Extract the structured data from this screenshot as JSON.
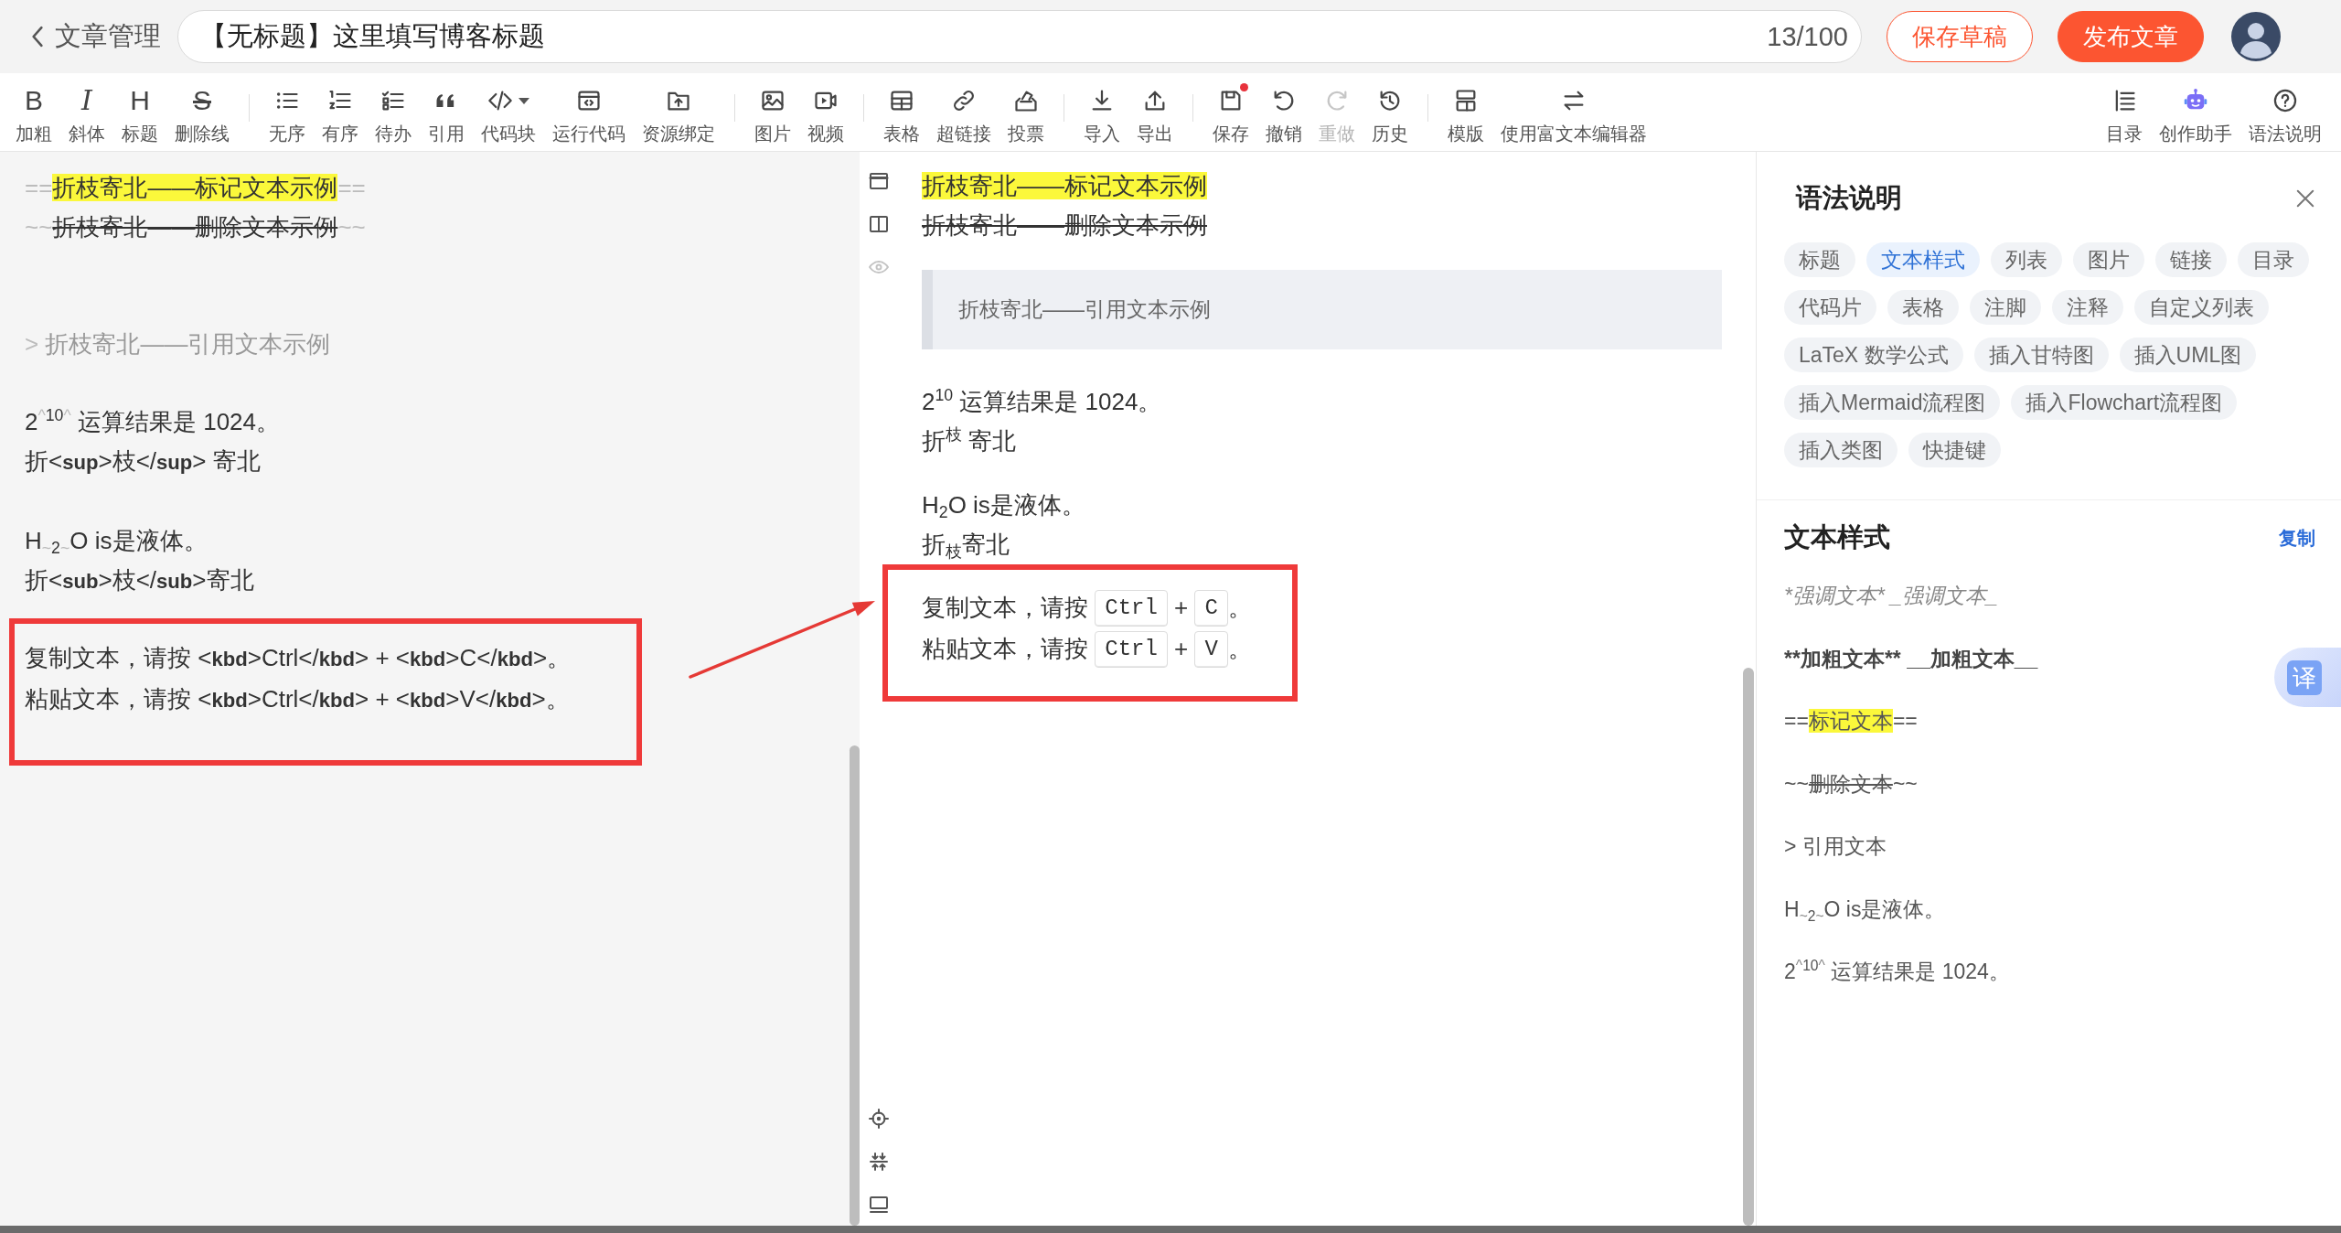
{
  "header": {
    "back": {
      "label": "文章管理"
    },
    "title_field": {
      "value": "【无标题】这里填写博客标题",
      "counter": "13/100"
    },
    "buttons": [
      {
        "label": "保存草稿",
        "kind": "outline"
      },
      {
        "label": "发布文章",
        "kind": "primary"
      }
    ]
  },
  "toolbar": {
    "groups": [
      [
        {
          "label": "加粗",
          "glyph": "B",
          "disabled": false,
          "dropdown": false,
          "dot": false
        },
        {
          "label": "斜体",
          "glyph": "I",
          "disabled": false,
          "dropdown": false,
          "dot": false
        },
        {
          "label": "标题",
          "glyph": "H",
          "disabled": false,
          "dropdown": false,
          "dot": false
        },
        {
          "label": "删除线",
          "glyph": "S",
          "disabled": false,
          "dropdown": false,
          "dot": false
        }
      ],
      [
        {
          "label": "无序",
          "disabled": false,
          "dropdown": false,
          "dot": false
        },
        {
          "label": "有序",
          "disabled": false,
          "dropdown": false,
          "dot": false
        },
        {
          "label": "待办",
          "disabled": false,
          "dropdown": false,
          "dot": false
        },
        {
          "label": "引用",
          "disabled": false,
          "dropdown": false,
          "dot": false
        },
        {
          "label": "代码块",
          "disabled": false,
          "dropdown": true,
          "dot": false
        },
        {
          "label": "运行代码",
          "disabled": false,
          "dropdown": false,
          "dot": false
        },
        {
          "label": "资源绑定",
          "disabled": false,
          "dropdown": false,
          "dot": false
        }
      ],
      [
        {
          "label": "图片",
          "disabled": false,
          "dropdown": false,
          "dot": false
        },
        {
          "label": "视频",
          "disabled": false,
          "dropdown": false,
          "dot": false
        }
      ],
      [
        {
          "label": "表格",
          "disabled": false,
          "dropdown": false,
          "dot": false
        },
        {
          "label": "超链接",
          "disabled": false,
          "dropdown": false,
          "dot": false
        },
        {
          "label": "投票",
          "disabled": false,
          "dropdown": false,
          "dot": false
        }
      ],
      [
        {
          "label": "导入",
          "disabled": false,
          "dropdown": false,
          "dot": false
        },
        {
          "label": "导出",
          "disabled": false,
          "dropdown": false,
          "dot": false
        }
      ],
      [
        {
          "label": "保存",
          "disabled": false,
          "dropdown": false,
          "dot": true
        },
        {
          "label": "撤销",
          "disabled": false,
          "dropdown": false,
          "dot": false
        },
        {
          "label": "重做",
          "disabled": true,
          "dropdown": false,
          "dot": false
        },
        {
          "label": "历史",
          "disabled": false,
          "dropdown": false,
          "dot": false
        }
      ],
      [
        {
          "label": "模版",
          "disabled": false,
          "dropdown": false,
          "dot": false
        },
        {
          "label": "使用富文本编辑器",
          "disabled": false,
          "dropdown": false,
          "dot": false
        }
      ]
    ],
    "right": [
      {
        "label": "目录"
      },
      {
        "label": "创作助手"
      },
      {
        "label": "语法说明"
      }
    ]
  },
  "editor": {
    "blocks": [
      {
        "annotated": false,
        "lines": [
          {
            "kind": "text",
            "segments": [
              {
                "kind": "marker",
                "text": "=="
              },
              {
                "kind": "mark",
                "text": "折枝寄北——标记文本示例"
              },
              {
                "kind": "marker",
                "text": "=="
              }
            ]
          },
          {
            "kind": "text",
            "segments": [
              {
                "kind": "marker",
                "text": "~~"
              },
              {
                "kind": "strike",
                "text": "折枝寄北——删除文本示例"
              },
              {
                "kind": "marker",
                "text": "~~"
              }
            ]
          },
          {
            "kind": "blank"
          },
          {
            "kind": "blank"
          },
          {
            "kind": "text",
            "segments": [
              {
                "kind": "marker",
                "text": ">"
              },
              {
                "kind": "quote",
                "text": " 折枝寄北——引用文本示例"
              }
            ]
          },
          {
            "kind": "blank"
          },
          {
            "kind": "text",
            "segments": [
              {
                "kind": "text",
                "text": "2"
              },
              {
                "kind": "sup_marker",
                "text": "^"
              },
              {
                "kind": "sup",
                "text": "10"
              },
              {
                "kind": "sup_marker",
                "text": "^"
              },
              {
                "kind": "text",
                "text": " 运算结果是 1024。"
              }
            ]
          },
          {
            "kind": "text",
            "segments": [
              {
                "kind": "text",
                "text": "折<"
              },
              {
                "kind": "tag",
                "text": "sup"
              },
              {
                "kind": "text",
                "text": ">枝</"
              },
              {
                "kind": "tag",
                "text": "sup"
              },
              {
                "kind": "text",
                "text": "> 寄北"
              }
            ]
          },
          {
            "kind": "blank"
          },
          {
            "kind": "text",
            "segments": [
              {
                "kind": "text",
                "text": "H"
              },
              {
                "kind": "sub_marker",
                "text": "~"
              },
              {
                "kind": "sub",
                "text": "2"
              },
              {
                "kind": "sub_marker",
                "text": "~"
              },
              {
                "kind": "text",
                "text": "O is是液体。"
              }
            ]
          },
          {
            "kind": "text",
            "segments": [
              {
                "kind": "text",
                "text": "折<"
              },
              {
                "kind": "tag",
                "text": "sub"
              },
              {
                "kind": "text",
                "text": ">枝</"
              },
              {
                "kind": "tag",
                "text": "sub"
              },
              {
                "kind": "text",
                "text": ">寄北"
              }
            ]
          }
        ]
      },
      {
        "annotated": true,
        "lines": [
          {
            "kind": "text",
            "segments": [
              {
                "kind": "text",
                "text": "复制文本，请按 <"
              },
              {
                "kind": "tag",
                "text": "kbd"
              },
              {
                "kind": "text",
                "text": ">Ctrl</"
              },
              {
                "kind": "tag",
                "text": "kbd"
              },
              {
                "kind": "text",
                "text": "> + <"
              },
              {
                "kind": "tag",
                "text": "kbd"
              },
              {
                "kind": "text",
                "text": ">C</"
              },
              {
                "kind": "tag",
                "text": "kbd"
              },
              {
                "kind": "text",
                "text": ">。"
              }
            ]
          },
          {
            "kind": "text",
            "segments": [
              {
                "kind": "text",
                "text": "粘贴文本，请按 <"
              },
              {
                "kind": "tag",
                "text": "kbd"
              },
              {
                "kind": "text",
                "text": ">Ctrl</"
              },
              {
                "kind": "tag",
                "text": "kbd"
              },
              {
                "kind": "text",
                "text": "> + <"
              },
              {
                "kind": "tag",
                "text": "kbd"
              },
              {
                "kind": "text",
                "text": ">V</"
              },
              {
                "kind": "tag",
                "text": "kbd"
              },
              {
                "kind": "text",
                "text": ">。"
              }
            ]
          }
        ]
      }
    ]
  },
  "annotation_arrow": true,
  "preview": {
    "blocks": [
      {
        "kind": "paragraph",
        "annotated": false,
        "lines": [
          {
            "kind": "text",
            "segments": [
              {
                "kind": "mark",
                "text": "折枝寄北——标记文本示例"
              }
            ]
          },
          {
            "kind": "text",
            "segments": [
              {
                "kind": "strike",
                "text": "折枝寄北——删除文本示例"
              }
            ]
          }
        ]
      },
      {
        "kind": "quote",
        "text": "折枝寄北——引用文本示例"
      },
      {
        "kind": "paragraph",
        "annotated": false,
        "lines": [
          {
            "kind": "text",
            "segments": [
              {
                "kind": "text",
                "text": "2"
              },
              {
                "kind": "sup",
                "text": "10"
              },
              {
                "kind": "text",
                "text": " 运算结果是 1024。"
              }
            ]
          },
          {
            "kind": "text",
            "segments": [
              {
                "kind": "text",
                "text": "折"
              },
              {
                "kind": "sup",
                "text": "枝"
              },
              {
                "kind": "text",
                "text": " 寄北"
              }
            ]
          }
        ]
      },
      {
        "kind": "paragraph",
        "annotated": false,
        "lines": [
          {
            "kind": "text",
            "segments": [
              {
                "kind": "text",
                "text": "H"
              },
              {
                "kind": "sub",
                "text": "2"
              },
              {
                "kind": "text",
                "text": "O is是液体。"
              }
            ]
          },
          {
            "kind": "text",
            "segments": [
              {
                "kind": "text",
                "text": "折"
              },
              {
                "kind": "sub",
                "text": "枝"
              },
              {
                "kind": "text",
                "text": "寄北"
              }
            ]
          }
        ]
      },
      {
        "kind": "paragraph",
        "annotated": true,
        "lines": [
          {
            "kind": "keys",
            "segments": [
              {
                "kind": "text",
                "text": "复制文本，请按 "
              },
              {
                "kind": "kbd",
                "text": "Ctrl"
              },
              {
                "kind": "text",
                "text": " + "
              },
              {
                "kind": "kbd",
                "text": "C"
              },
              {
                "kind": "text",
                "text": "。"
              }
            ]
          },
          {
            "kind": "keys",
            "segments": [
              {
                "kind": "text",
                "text": "粘贴文本，请按 "
              },
              {
                "kind": "kbd",
                "text": "Ctrl"
              },
              {
                "kind": "text",
                "text": " + "
              },
              {
                "kind": "kbd",
                "text": "V"
              },
              {
                "kind": "text",
                "text": "。"
              }
            ]
          }
        ]
      }
    ]
  },
  "syntax_panel": {
    "title": "语法说明",
    "tags": [
      {
        "label": "标题",
        "selected": false
      },
      {
        "label": "文本样式",
        "selected": true
      },
      {
        "label": "列表",
        "selected": false
      },
      {
        "label": "图片",
        "selected": false
      },
      {
        "label": "链接",
        "selected": false
      },
      {
        "label": "目录",
        "selected": false
      },
      {
        "label": "代码片",
        "selected": false
      },
      {
        "label": "表格",
        "selected": false
      },
      {
        "label": "注脚",
        "selected": false
      },
      {
        "label": "注释",
        "selected": false
      },
      {
        "label": "自定义列表",
        "selected": false
      },
      {
        "label": "LaTeX 数学公式",
        "selected": false
      },
      {
        "label": "插入甘特图",
        "selected": false
      },
      {
        "label": "插入UML图",
        "selected": false
      },
      {
        "label": "插入Mermaid流程图",
        "selected": false
      },
      {
        "label": "插入Flowchart流程图",
        "selected": false
      },
      {
        "label": "插入类图",
        "selected": false
      },
      {
        "label": "快捷键",
        "selected": false
      }
    ],
    "section": {
      "title": "文本样式",
      "copy": "复制",
      "lines": [
        {
          "segments": [
            {
              "kind": "italic",
              "text": "*强调文本* _强调文本_"
            }
          ]
        },
        {
          "segments": [
            {
              "kind": "bold",
              "text": "**加粗文本** __加粗文本__"
            }
          ]
        },
        {
          "segments": [
            {
              "kind": "text",
              "text": "=="
            },
            {
              "kind": "mark",
              "text": "标记文本"
            },
            {
              "kind": "text",
              "text": "=="
            }
          ]
        },
        {
          "segments": [
            {
              "kind": "text",
              "text": "~~"
            },
            {
              "kind": "strike",
              "text": "删除文本"
            },
            {
              "kind": "text",
              "text": "~~"
            }
          ]
        },
        {
          "segments": [
            {
              "kind": "text",
              "text": "> 引用文本"
            }
          ]
        },
        {
          "segments": [
            {
              "kind": "text",
              "text": "H"
            },
            {
              "kind": "sub_marker",
              "text": "~"
            },
            {
              "kind": "sub",
              "text": "2"
            },
            {
              "kind": "sub_marker",
              "text": "~"
            },
            {
              "kind": "text",
              "text": "O is是液体。"
            }
          ]
        },
        {
          "segments": [
            {
              "kind": "text",
              "text": "2"
            },
            {
              "kind": "sup_marker",
              "text": "^"
            },
            {
              "kind": "sup",
              "text": "10"
            },
            {
              "kind": "sup_marker",
              "text": "^"
            },
            {
              "kind": "text",
              "text": " 运算结果是 1024。"
            }
          ]
        }
      ]
    }
  },
  "translate_button": {
    "label": "译"
  }
}
